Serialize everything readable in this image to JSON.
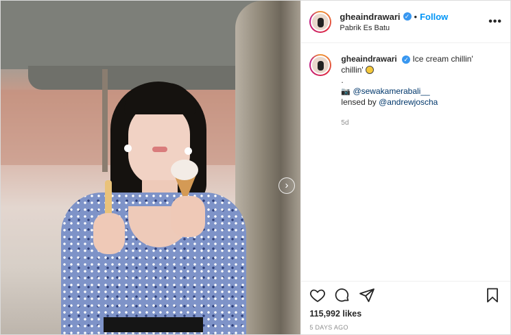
{
  "post": {
    "username": "gheaindrawari",
    "follow_label": "Follow",
    "dot": "•",
    "location": "Pabrik Es Batu",
    "more_label": "•••"
  },
  "caption": {
    "username": "gheaindrawari",
    "text": "Ice cream chillin' chillin'",
    "separator": ".",
    "camera_icon": "📷",
    "credit_handle": "@sewakamerabali__",
    "lensed_prefix": "lensed by",
    "lensed_handle": "@andrewjoscha",
    "age": "5d"
  },
  "engagement": {
    "likes": "115,992 likes",
    "posted": "5 DAYS AGO"
  },
  "icons": {
    "next": "chevron-right-icon",
    "like": "heart-icon",
    "comment": "comment-icon",
    "share": "send-icon",
    "save": "bookmark-icon"
  },
  "colors": {
    "follow": "#0095f6",
    "verified": "#3897f0",
    "muted": "#8e8e8e"
  }
}
